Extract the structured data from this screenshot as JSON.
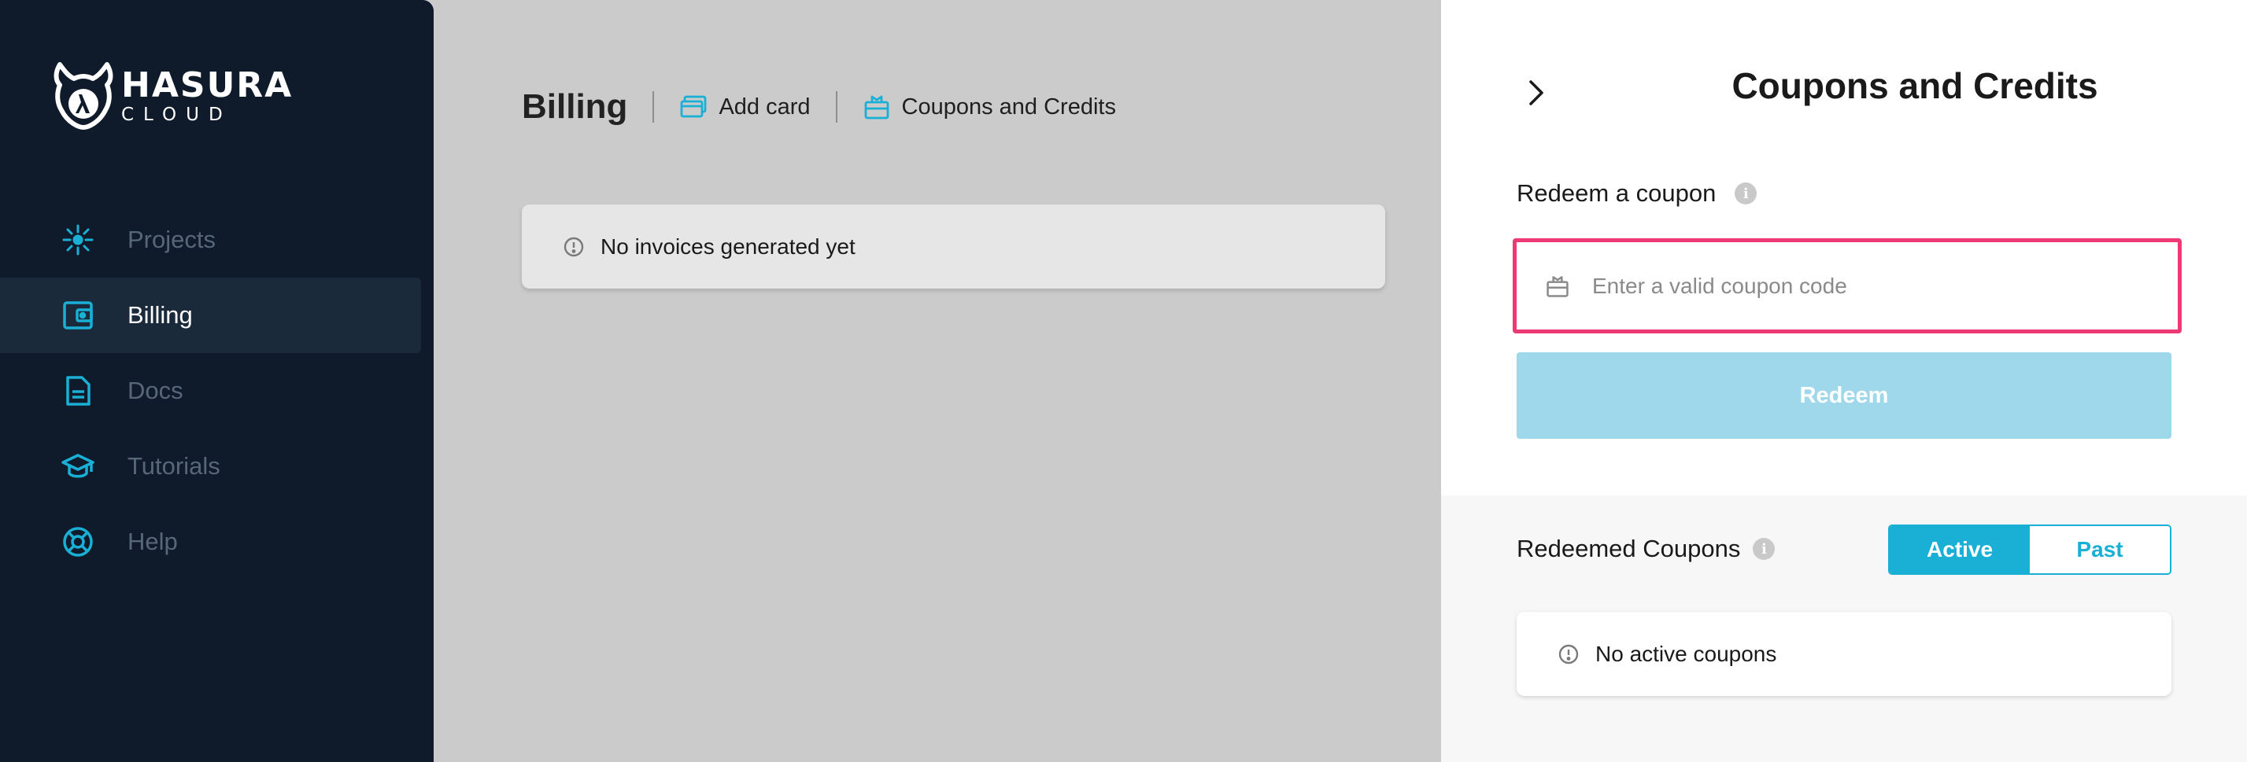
{
  "brand": {
    "name": "HASURA",
    "sub": "CLOUD"
  },
  "sidebar": {
    "items": [
      {
        "label": "Projects",
        "icon": "projects-icon"
      },
      {
        "label": "Billing",
        "icon": "wallet-icon",
        "active": true
      },
      {
        "label": "Docs",
        "icon": "document-icon"
      },
      {
        "label": "Tutorials",
        "icon": "graduation-cap-icon"
      },
      {
        "label": "Help",
        "icon": "lifebuoy-icon"
      }
    ]
  },
  "main": {
    "title": "Billing",
    "add_card": "Add card",
    "coupons_link": "Coupons and Credits",
    "empty_invoices": "No invoices generated yet"
  },
  "panel": {
    "title": "Coupons and Credits",
    "redeem_label": "Redeem a coupon",
    "coupon_placeholder": "Enter a valid coupon code",
    "coupon_value": "",
    "redeem_button": "Redeem",
    "redeemed_label": "Redeemed Coupons",
    "toggle_active": "Active",
    "toggle_past": "Past",
    "empty_coupons": "No active coupons"
  },
  "colors": {
    "sidebar_bg": "#0f1b2a",
    "accent": "#1ab0d6",
    "highlight": "#ee3a74",
    "redeem_disabled": "#9fd8ea"
  }
}
